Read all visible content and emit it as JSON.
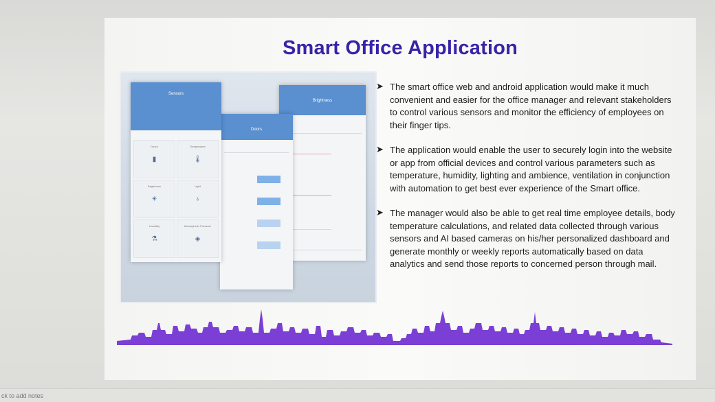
{
  "slide": {
    "title": "Smart Office Application",
    "bullets": [
      "The smart office web and android application would make it much convenient and easier for the office manager and relevant stakeholders to control various sensors and monitor the efficiency of employees on their finger tips.",
      "The application would enable the user to securely login into the website or app from official devices and control various parameters such as temperature, humidity, lighting and ambience, ventilation in conjunction with automation to get best ever experience of the Smart office.",
      "The manager would also be able to get real time employee details, body temperature calculations, and related data collected through various sensors and AI based cameras on his/her personalized dashboard and generate monthly or weekly reports automatically based on data analytics and send those reports to concerned person through mail."
    ],
    "bullet_icon": "arrow-bullet-icon"
  },
  "mockup": {
    "sensors_screen": {
      "title": "Sensors",
      "tiles": [
        {
          "label": "Doors",
          "icon": "door-icon"
        },
        {
          "label": "Temperature",
          "icon": "thermometer-icon"
        },
        {
          "label": "Brightness",
          "icon": "sun-icon"
        },
        {
          "label": "Light",
          "icon": "bulb-icon"
        },
        {
          "label": "Humidity",
          "icon": "humidity-icon"
        },
        {
          "label": "Atmospheric Pressure",
          "icon": "pressure-icon"
        }
      ]
    },
    "doors_screen": {
      "title": "Doors"
    },
    "brightness_screen": {
      "title": "Brightness"
    }
  },
  "colors": {
    "title": "#3a22a8",
    "app_bar": "#5a8fd0",
    "skyline": "#7b3fd6"
  },
  "footer": {
    "notes_hint": "ck to add notes"
  }
}
